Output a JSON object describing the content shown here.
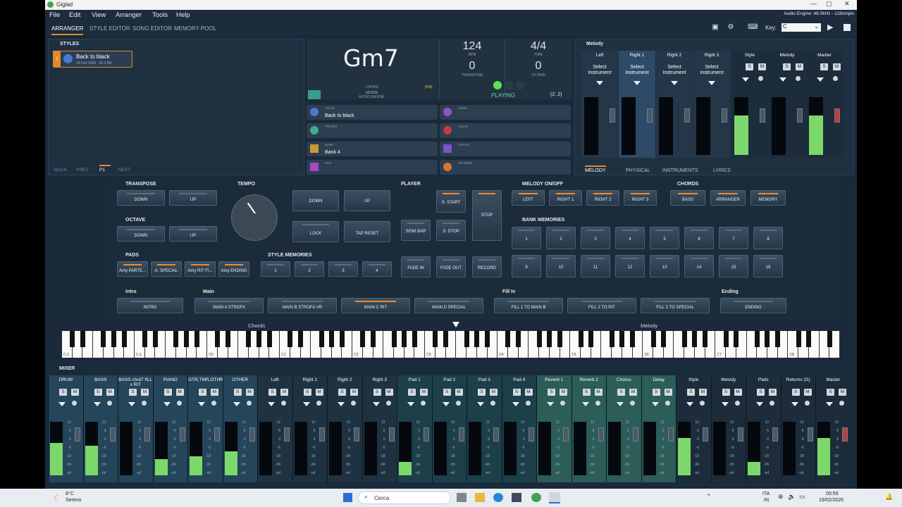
{
  "window": {
    "title": "Giglad",
    "engine": "Audio Engine: 48.0kHz - 128smpls"
  },
  "menu": [
    "File",
    "Edit",
    "View",
    "Arranger",
    "Tools",
    "Help"
  ],
  "tabs": [
    "ARRANGER",
    "STYLE EDITOR",
    "SONG EDITOR",
    "MEMORY POOL"
  ],
  "key": {
    "label": "Key:",
    "value": "C"
  },
  "styles": {
    "title": "STYLES",
    "item": {
      "index": "1",
      "name": "Back to black",
      "meta": "19 Feb 2026 · 26.2 KB"
    },
    "nav": [
      "BACK",
      "PREV",
      "P1",
      "NEXT"
    ]
  },
  "display": {
    "chord": "Gm7",
    "chord_label": "CHORD",
    "chord_ref": "(F.B)",
    "bpm": "124",
    "bpm_label": "BPM",
    "time": "4/4",
    "time_label": "TIME",
    "transpose": "0",
    "transpose_label": "TRANSPOSE",
    "octave": "0",
    "octave_label": "OCTAVE",
    "engine_pct": "10.01%",
    "engine_label": "AUDIO ENGINE",
    "state": "PLAYING",
    "pos": "(2, 2)"
  },
  "info": [
    {
      "k": "STYLE",
      "v": "Back to black"
    },
    {
      "k": "SONG",
      "v": ""
    },
    {
      "k": "PRESET",
      "v": ""
    },
    {
      "k": "AUDIO",
      "v": ""
    },
    {
      "k": "BANK",
      "v": "Bank 4"
    },
    {
      "k": "LYRICS",
      "v": ""
    },
    {
      "k": "PAD",
      "v": ""
    },
    {
      "k": "PATTERN",
      "v": ""
    }
  ],
  "melody": {
    "title": "Melody",
    "channels": [
      "Left",
      "Right 1",
      "Right 2",
      "Right 3"
    ],
    "select": "Select Instrument",
    "mix": [
      "Style",
      "Melody",
      "Master"
    ],
    "tabs": [
      "MELODY",
      "PHYSICAL",
      "INSTRUMENTS",
      "LYRICS"
    ]
  },
  "transpose": {
    "title": "TRANSPOSE",
    "down": "DOWN",
    "up": "UP"
  },
  "octave": {
    "title": "OCTAVE",
    "down": "DOWN",
    "up": "UP"
  },
  "tempo": {
    "title": "TEMPO",
    "down": "DOWN",
    "up": "UP",
    "lock": "LOCK",
    "tap": "TAP RESET"
  },
  "player": {
    "title": "PLAYER",
    "start": "S. START",
    "stop": "STOP",
    "semibar": "SEMI BAR",
    "sstop": "S. STOP",
    "fadein": "FADE IN",
    "fadeout": "FADE OUT",
    "record": "RECORD"
  },
  "melody_onoff": {
    "title": "MELODY ON/OFF",
    "items": [
      "LEFT",
      "RIGHT 1",
      "RIGHT 2",
      "RIGHT 3"
    ]
  },
  "chords": {
    "title": "CHORDS",
    "items": [
      "BASS",
      "ARRANGER",
      "MEMORY"
    ]
  },
  "bank_memories": {
    "title": "BANK MEMORIES",
    "items": [
      "1",
      "2",
      "3",
      "4",
      "5",
      "6",
      "7",
      "8",
      "9",
      "10",
      "11",
      "12",
      "13",
      "14",
      "15",
      "16"
    ]
  },
  "pads": {
    "title": "PADS",
    "items": [
      "Amy PARTE...",
      "A. SPECIAL",
      "Amy RIT FI...",
      "Amy ENDING"
    ]
  },
  "style_memories": {
    "title": "STYLE MEMORIES",
    "items": [
      "1",
      "2",
      "3",
      "4"
    ]
  },
  "intro": {
    "title": "Intro",
    "items": [
      "INTRO"
    ]
  },
  "main": {
    "title": "Main",
    "items": [
      "MAIN A STROFA",
      "MAIN B STROFA VR",
      "MAIN C RIT",
      "MAIN D SPECIAL"
    ]
  },
  "fillin": {
    "title": "Fill In",
    "items": [
      "FILL 1 TO MAIN B",
      "FILL 2 TO RIT",
      "FILL 3 TO SPECIAL"
    ]
  },
  "ending": {
    "title": "Ending",
    "items": [
      "ENDING"
    ]
  },
  "keyboard": {
    "left": "Chords",
    "right": "Melody",
    "octaves": [
      "C-2",
      "C-1",
      "C0",
      "C1",
      "C2",
      "C3",
      "C4",
      "C5",
      "C6",
      "C7",
      "C8"
    ]
  },
  "mixer": {
    "title": "MIXER",
    "channels": [
      {
        "name": "DRUM",
        "level": 0.6
      },
      {
        "name": "BASS",
        "level": 0.55
      },
      {
        "name": "BASS chrd7 fILL x RIT",
        "level": 0
      },
      {
        "name": "PIANO",
        "level": 0.3
      },
      {
        "name": "GTR,TMR,OTHR",
        "level": 0.35
      },
      {
        "name": "OTHER",
        "level": 0.45
      },
      {
        "name": "Left",
        "level": 0
      },
      {
        "name": "Right 1",
        "level": 0
      },
      {
        "name": "Right 2",
        "level": 0
      },
      {
        "name": "Right 3",
        "level": 0
      },
      {
        "name": "Pad 1",
        "level": 0.25
      },
      {
        "name": "Pad 2",
        "level": 0
      },
      {
        "name": "Pad 3",
        "level": 0
      },
      {
        "name": "Pad 4",
        "level": 0
      },
      {
        "name": "Reverb 1",
        "level": 0
      },
      {
        "name": "Reverb 2",
        "level": 0
      },
      {
        "name": "Chorus",
        "level": 0
      },
      {
        "name": "Delay",
        "level": 0
      },
      {
        "name": "Style",
        "level": 0.7
      },
      {
        "name": "Melody",
        "level": 0
      },
      {
        "name": "Pads",
        "level": 0.25
      },
      {
        "name": "Returns (G)",
        "level": 0
      },
      {
        "name": "Master",
        "level": 0.7
      }
    ],
    "scale": [
      "12",
      "6",
      "0",
      "-6",
      "-18",
      "-36",
      "-inf"
    ],
    "s": "S",
    "m": "M",
    "pan": "Pan"
  },
  "taskbar": {
    "temp": "8°C",
    "weather": "Sereno",
    "search": "Cerca",
    "lang": "ITA",
    "region": "IN",
    "time": "00:59",
    "date": "19/02/2026"
  }
}
